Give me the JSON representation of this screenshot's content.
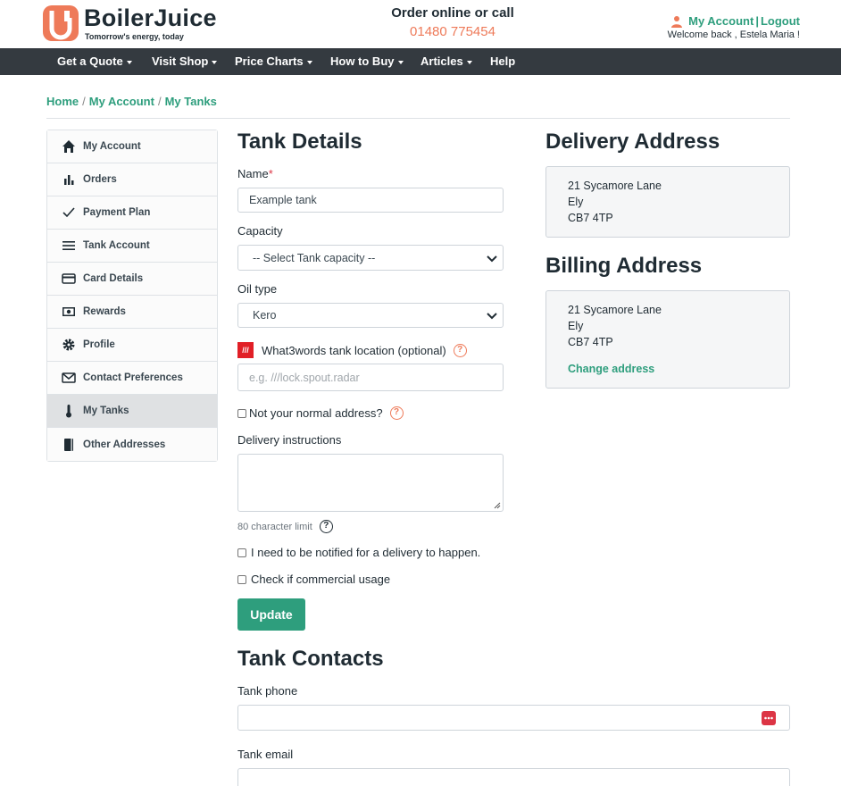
{
  "header": {
    "brand": "BoilerJuice",
    "tagline": "Tomorrow's energy, today",
    "order_line": "Order online or call",
    "phone": "01480 775454",
    "my_account": "My Account",
    "separator": "|",
    "logout": "Logout",
    "welcome": "Welcome back , Estela Maria !"
  },
  "nav": [
    "Get a Quote",
    "Visit Shop",
    "Price Charts",
    "How to Buy",
    "Articles",
    "Help"
  ],
  "breadcrumb": [
    "Home",
    "My Account",
    "My Tanks"
  ],
  "sidebar": [
    {
      "label": "My Account",
      "icon": "home-icon"
    },
    {
      "label": "Orders",
      "icon": "bar-chart-icon"
    },
    {
      "label": "Payment Plan",
      "icon": "check-icon"
    },
    {
      "label": "Tank Account",
      "icon": "menu-lines-icon"
    },
    {
      "label": "Card Details",
      "icon": "credit-card-icon"
    },
    {
      "label": "Rewards",
      "icon": "cash-icon"
    },
    {
      "label": "Profile",
      "icon": "gear-icon"
    },
    {
      "label": "Contact Preferences",
      "icon": "envelope-icon"
    },
    {
      "label": "My Tanks",
      "icon": "thermometer-icon"
    },
    {
      "label": "Other Addresses",
      "icon": "book-icon"
    }
  ],
  "tank_details": {
    "title": "Tank Details",
    "name_label": "Name",
    "name_required": "*",
    "name_value": "Example tank",
    "capacity_label": "Capacity",
    "capacity_value": "-- Select Tank capacity --",
    "oil_label": "Oil type",
    "oil_value": "Kero",
    "w3w_badge": "///",
    "w3w_label": "What3words tank location (optional)",
    "w3w_placeholder": "e.g. ///lock.spout.radar",
    "not_normal_label": "Not your normal address?",
    "instructions_label": "Delivery instructions",
    "char_limit": "80 character limit",
    "notify_label": "I need to be notified for a delivery to happen.",
    "commercial_label": "Check if commercial usage",
    "update_button": "Update",
    "help_glyph": "?"
  },
  "tank_contacts": {
    "title": "Tank Contacts",
    "phone_label": "Tank phone",
    "email_label": "Tank email"
  },
  "delivery_address": {
    "title": "Delivery Address",
    "lines": [
      "21 Sycamore Lane",
      "Ely",
      "CB7 4TP"
    ]
  },
  "billing_address": {
    "title": "Billing Address",
    "lines": [
      "21 Sycamore Lane",
      "Ely",
      "CB7 4TP"
    ],
    "change_link": "Change address"
  },
  "colors": {
    "accent_green": "#2e9e7d",
    "brand_orange": "#ee7a59",
    "nav_dark": "#343a40",
    "w3w_red": "#e11f26"
  }
}
